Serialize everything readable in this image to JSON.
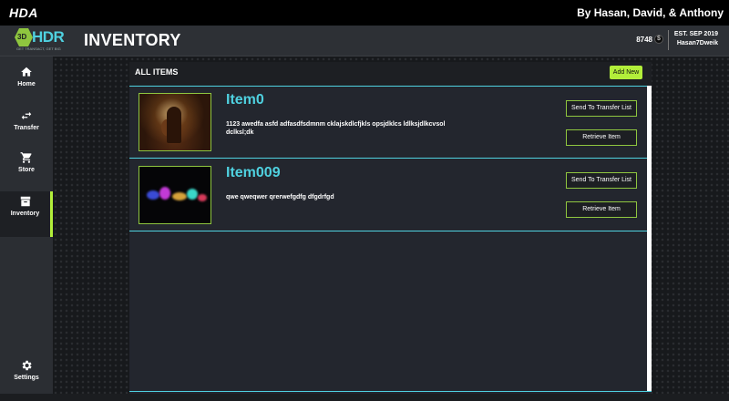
{
  "window": {
    "app_name": "HDA",
    "authors": "By Hasan, David, & Anthony"
  },
  "header": {
    "logo_badge": "3D",
    "logo_word": "HDR",
    "logo_tagline": "GET TRANSACT, GET BIG",
    "title": "INVENTORY",
    "coins": "8748",
    "coin_symbol": "$",
    "est": "EST. SEP 2019",
    "username": "Hasan7Dweik"
  },
  "sidebar": {
    "items": [
      {
        "label": "Home",
        "icon": "home-icon"
      },
      {
        "label": "Transfer",
        "icon": "transfer-icon"
      },
      {
        "label": "Store",
        "icon": "cart-icon"
      },
      {
        "label": "Inventory",
        "icon": "archive-icon",
        "active": true
      },
      {
        "label": "Settings",
        "icon": "gear-icon"
      }
    ]
  },
  "panel": {
    "title": "ALL ITEMS",
    "add_label": "Add New"
  },
  "items": [
    {
      "name": "Item0",
      "description": "1123 awedfa asfd adfasdfsdmnm cklajskdlcfjkls opsjdklcs ldlksjdlkcvsol dclksl;dk",
      "transfer_label": "Send To Transfer List",
      "retrieve_label": "Retrieve Item"
    },
    {
      "name": "Item009",
      "description": "qwe qweqwer qrerwefgdfg dfgdrfgd",
      "transfer_label": "Send To Transfer List",
      "retrieve_label": "Retrieve Item"
    }
  ],
  "colors": {
    "accent_cyan": "#4fd1e0",
    "accent_green": "#b2ee3a",
    "panel": "#23262e"
  }
}
